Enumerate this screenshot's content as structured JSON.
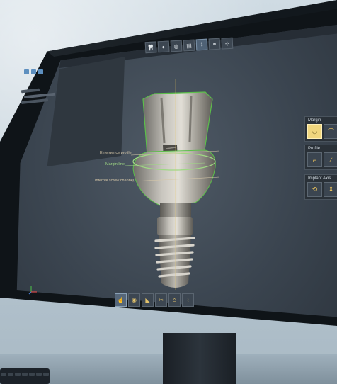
{
  "app": {
    "window_title": ""
  },
  "top_toolbar": {
    "buttons": [
      {
        "icon": "tooth-view-icon",
        "glyph": "🦷",
        "active": true
      },
      {
        "icon": "bite-icon",
        "glyph": "◐",
        "active": false
      },
      {
        "icon": "crown-icon",
        "glyph": "◍",
        "active": false
      },
      {
        "icon": "bridge-icon",
        "glyph": "▤",
        "active": false
      },
      {
        "icon": "implant-icon",
        "glyph": "⟟",
        "active": false
      },
      {
        "icon": "share-icon",
        "glyph": "⚭",
        "active": false
      },
      {
        "icon": "settings-icon",
        "glyph": "⊹",
        "active": false
      }
    ]
  },
  "right_panel": {
    "groups": [
      {
        "title": "Margin",
        "buttons": [
          {
            "icon": "margin-curve-icon",
            "glyph": "◡",
            "active": true
          },
          {
            "icon": "margin-shoulder-icon",
            "glyph": "⌒",
            "active": false
          }
        ]
      },
      {
        "title": "Profile",
        "buttons": [
          {
            "icon": "profile-concave-icon",
            "glyph": "⌐",
            "active": false
          },
          {
            "icon": "profile-flat-icon",
            "glyph": "∕",
            "active": false
          }
        ]
      },
      {
        "title": "Implant Axis",
        "buttons": [
          {
            "icon": "axis-rotate-icon",
            "glyph": "⟲",
            "active": false
          },
          {
            "icon": "axis-move-icon",
            "glyph": "⇕",
            "active": false
          }
        ]
      }
    ]
  },
  "viewport": {
    "callouts": {
      "emergence": "Emergence profile",
      "margin": "Margin line",
      "screw": "Internal screw channel"
    }
  },
  "bottom_toolbar": {
    "buttons": [
      {
        "icon": "select-icon",
        "glyph": "☝",
        "active": true
      },
      {
        "icon": "sculpt-icon",
        "glyph": "◉",
        "active": false
      },
      {
        "icon": "smooth-icon",
        "glyph": "◣",
        "active": false
      },
      {
        "icon": "cut-icon",
        "glyph": "✂",
        "active": false
      },
      {
        "icon": "tooth-icon",
        "glyph": "♙",
        "active": false
      },
      {
        "icon": "measure-icon",
        "glyph": "⌇",
        "active": false
      }
    ]
  },
  "colors": {
    "accent_highlight": "#f0d67e",
    "margin_line": "#9fd884",
    "callout_line": "#d6c7a8"
  }
}
